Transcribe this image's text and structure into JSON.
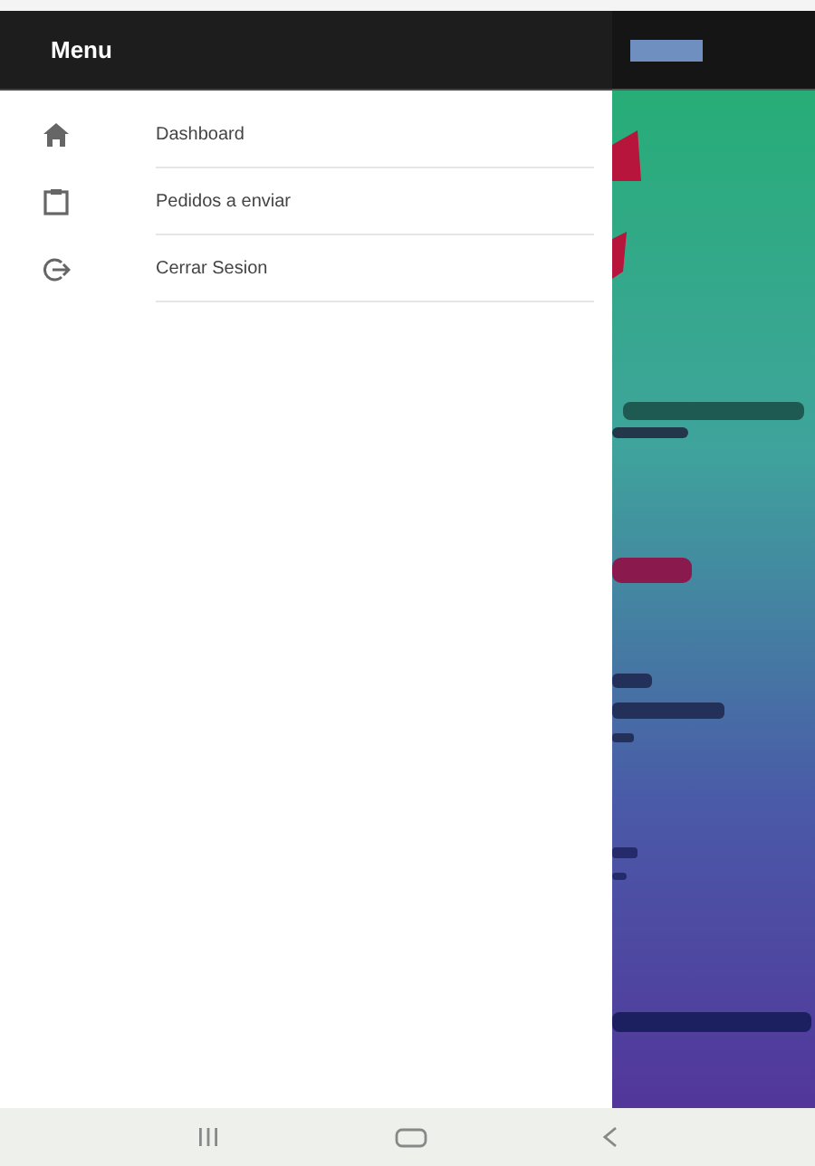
{
  "drawer": {
    "title": "Menu",
    "items": [
      {
        "label": "Dashboard"
      },
      {
        "label": "Pedidos a enviar"
      },
      {
        "label": "Cerrar Sesion"
      }
    ]
  }
}
